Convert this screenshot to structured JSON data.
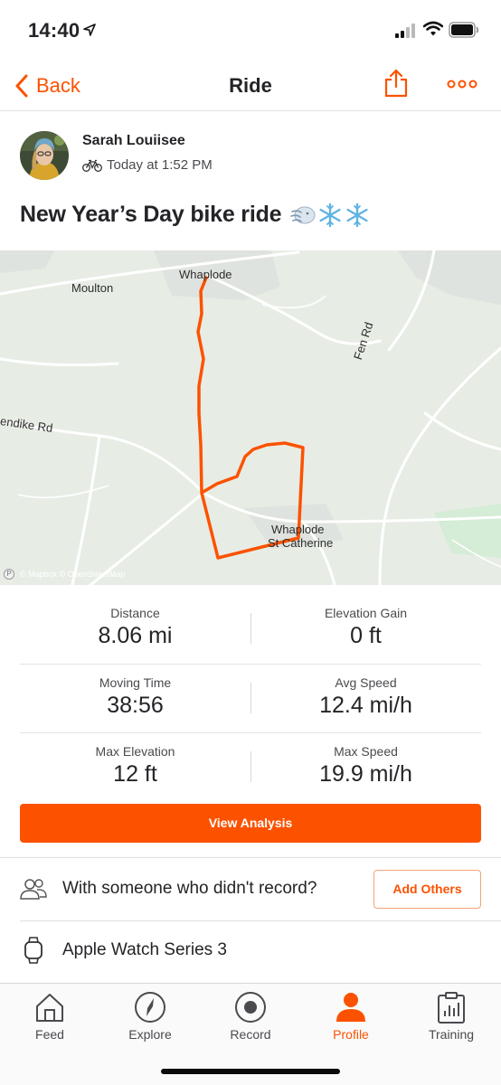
{
  "status_bar": {
    "time": "14:40",
    "icons": [
      "location-arrow-icon",
      "signal-icon",
      "wifi-icon",
      "battery-icon"
    ]
  },
  "nav": {
    "back_label": "Back",
    "title": "Ride",
    "share_icon": "share-icon",
    "more_icon": "more-dots-icon"
  },
  "athlete": {
    "name": "Sarah Louiisee",
    "activity_type_icon": "bike-icon",
    "time": "Today at 1:52 PM"
  },
  "activity": {
    "title": "New Year’s Day bike ride",
    "title_emoji": [
      "wind-face-icon",
      "snowflake-icon",
      "snowflake-icon"
    ]
  },
  "map": {
    "labels": {
      "whaplode": "Whaplode",
      "moulton": "Moulton",
      "fen_rd": "Fen Rd",
      "endike_rd": "endike Rd",
      "whaplode_st_catherine_1": "Whaplode",
      "whaplode_st_catherine_2": "St Catherine"
    },
    "attribution": "© Mapbox © OpenStreetMap",
    "route_color": "#fc5200"
  },
  "stats": {
    "distance": {
      "label": "Distance",
      "value": "8.06 mi"
    },
    "elevation_gain": {
      "label": "Elevation Gain",
      "value": "0 ft"
    },
    "moving_time": {
      "label": "Moving Time",
      "value": "38:56"
    },
    "avg_speed": {
      "label": "Avg Speed",
      "value": "12.4 mi/h"
    },
    "max_elevation": {
      "label": "Max Elevation",
      "value": "12 ft"
    },
    "max_speed": {
      "label": "Max Speed",
      "value": "19.9 mi/h"
    }
  },
  "view_analysis_label": "View Analysis",
  "with_others": {
    "text": "With someone who didn't record?",
    "button_label": "Add Others"
  },
  "device": {
    "text": "Apple Watch Series 3",
    "icon": "watch-icon"
  },
  "tabs": [
    {
      "label": "Feed",
      "icon": "home-icon",
      "active": false
    },
    {
      "label": "Explore",
      "icon": "compass-icon",
      "active": false
    },
    {
      "label": "Record",
      "icon": "record-icon",
      "active": false
    },
    {
      "label": "Profile",
      "icon": "person-icon",
      "active": true
    },
    {
      "label": "Training",
      "icon": "clipboard-chart-icon",
      "active": false
    }
  ],
  "colors": {
    "accent": "#fc5200",
    "text": "#242428",
    "map_background": "#e7ede5"
  }
}
